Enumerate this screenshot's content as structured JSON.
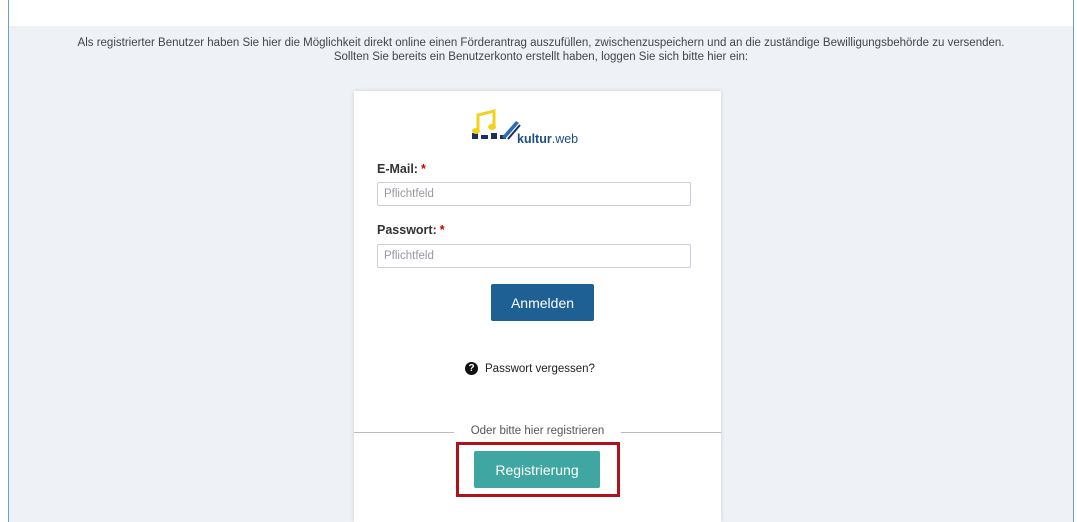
{
  "intro": {
    "line1": "Als registrierter Benutzer haben Sie hier die Möglichkeit direkt online einen Förderantrag auszufüllen, zwischenzuspeichern und an die zuständige Bewilligungsbehörde zu versenden.",
    "line2": "Sollten Sie bereits ein Benutzerkonto erstellt haben, loggen Sie sich bitte hier ein:"
  },
  "logo": {
    "name": "kultur",
    "suffix": ".web"
  },
  "form": {
    "email_label": "E-Mail:",
    "email_placeholder": "Pflichtfeld",
    "password_label": "Passwort:",
    "password_placeholder": "Pflichtfeld",
    "required_marker": "*",
    "login_button": "Anmelden",
    "forgot_password": "Passwort vergessen?"
  },
  "register": {
    "divider_text": "Oder bitte hier registrieren",
    "button": "Registrierung"
  },
  "colors": {
    "login_button": "#1e5f94",
    "register_button": "#3fa6a1",
    "highlight_border": "#b0121b",
    "required": "#cc0000"
  }
}
